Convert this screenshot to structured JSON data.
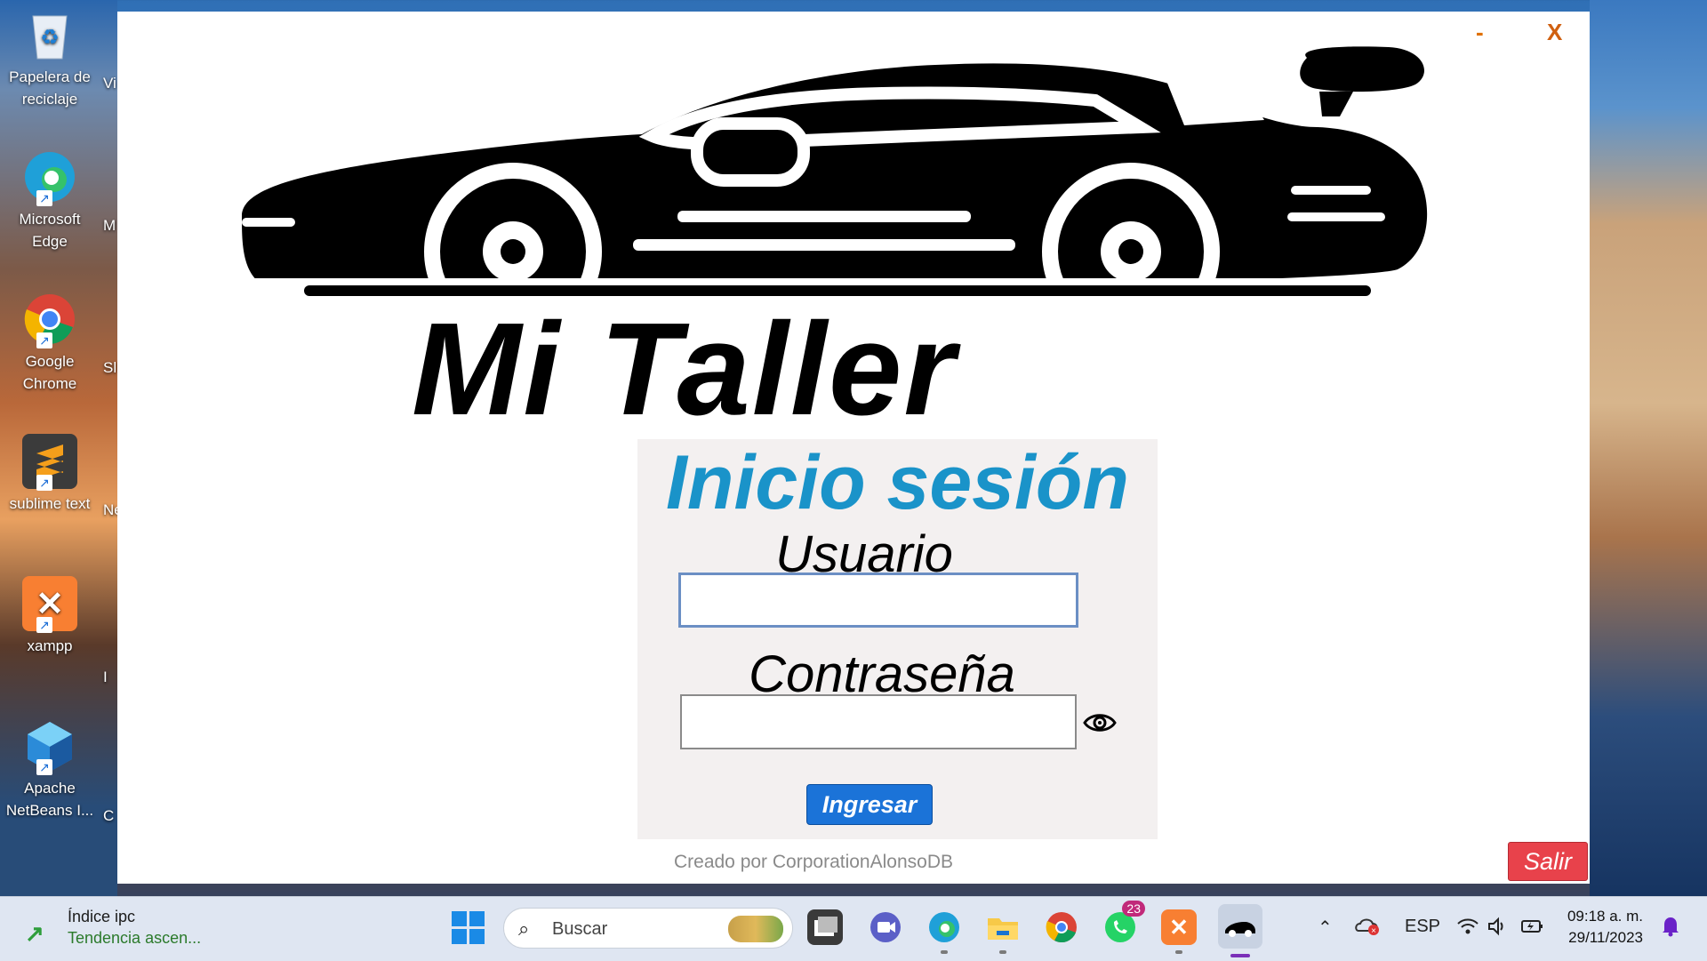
{
  "desktop": {
    "icons": [
      {
        "label": "Papelera de reciclaje"
      },
      {
        "label": "Microsoft Edge"
      },
      {
        "label": "Google Chrome"
      },
      {
        "label": "sublime text"
      },
      {
        "label": "xampp"
      },
      {
        "label": "Apache NetBeans I..."
      }
    ],
    "cut_labels": [
      "Vi",
      "M",
      "Sl",
      "Ne",
      "I",
      "C"
    ]
  },
  "window": {
    "minimize_label": "-",
    "close_label": "X",
    "app_title": "Mi Taller",
    "login": {
      "heading": "Inicio sesión",
      "user_label": "Usuario",
      "user_value": "",
      "password_label": "Contraseña",
      "password_value": "",
      "submit_label": "Ingresar"
    },
    "credits": "Creado por CorporationAlonsoDB",
    "exit_label": "Salir"
  },
  "taskbar": {
    "widget": {
      "title": "Índice ipc",
      "subtitle": "Tendencia ascen..."
    },
    "search_placeholder": "Buscar",
    "apps": [
      {
        "name": "task-view"
      },
      {
        "name": "teams-chat"
      },
      {
        "name": "edge"
      },
      {
        "name": "file-explorer"
      },
      {
        "name": "chrome"
      },
      {
        "name": "whatsapp",
        "badge": "23"
      },
      {
        "name": "xampp"
      },
      {
        "name": "mi-taller"
      }
    ],
    "tray": {
      "language": "ESP"
    },
    "clock": {
      "time": "09:18 a. m.",
      "date": "29/11/2023"
    }
  },
  "colors": {
    "heading": "#1a93c9",
    "submit_button": "#1b73d8",
    "exit_button": "#e8424b",
    "window_controls": "#e07000"
  }
}
